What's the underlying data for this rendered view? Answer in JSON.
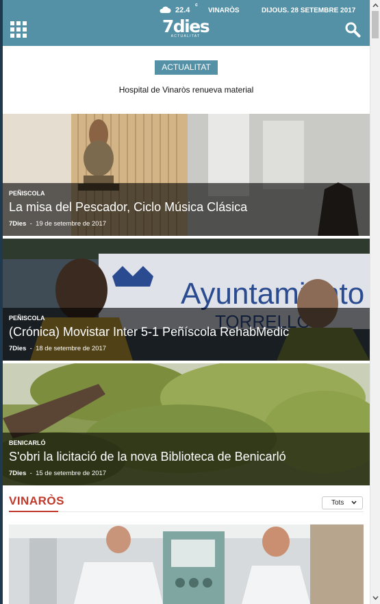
{
  "header": {
    "temperature": "22.4",
    "degree_unit": "c",
    "city": "VINARÒS",
    "date": "DIJOUS. 28 SETEMBRE 2017",
    "logo_main": "7dies",
    "logo_sub": "ACTUALITAT",
    "weather_icon": "cloud-icon",
    "menu_icon": "grid-menu-icon",
    "search_icon": "search-icon",
    "bg_color": "#5591a6"
  },
  "featured": {
    "section_tag": "ACTUALITAT",
    "headline": "Hospital de Vinaròs renueva material"
  },
  "articles": [
    {
      "category": "PEÑISCOLA",
      "title": "La misa del Pescador, Ciclo Música Clásica",
      "author": "7Dies",
      "date": "19 de setembre de 2017"
    },
    {
      "category": "PEÑISCOLA",
      "title": "(Crónica) Movistar Inter 5-1 Peñíscola RehabMedic",
      "author": "7Dies",
      "date": "18 de setembre de 2017"
    },
    {
      "category": "BENICARLÓ",
      "title": "S'obri la licitació de la nova Biblioteca de Benicarló",
      "author": "7Dies",
      "date": "15 de setembre de 2017"
    }
  ],
  "section": {
    "title": "VINARÒS",
    "accent_color": "#c0392b",
    "filter_value": "Tots"
  },
  "meta_separator": "-"
}
